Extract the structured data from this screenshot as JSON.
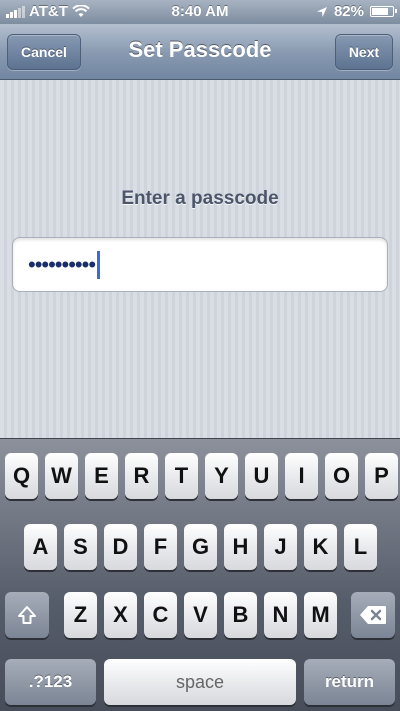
{
  "status_bar": {
    "carrier": "AT&T",
    "time": "8:40 AM",
    "battery_percent": "82%",
    "battery_level": 0.82,
    "signal_icon": "signal-bars-icon",
    "wifi_icon": "wifi-icon",
    "location_icon": "location-arrow-icon"
  },
  "nav": {
    "cancel_label": "Cancel",
    "title": "Set Passcode",
    "next_label": "Next"
  },
  "main": {
    "prompt": "Enter a passcode",
    "passcode_masked": "••••••••••"
  },
  "keyboard": {
    "row1": [
      "Q",
      "W",
      "E",
      "R",
      "T",
      "Y",
      "U",
      "I",
      "O",
      "P"
    ],
    "row2": [
      "A",
      "S",
      "D",
      "F",
      "G",
      "H",
      "J",
      "K",
      "L"
    ],
    "row3": [
      "Z",
      "X",
      "C",
      "V",
      "B",
      "N",
      "M"
    ],
    "shift_icon": "shift-arrow-icon",
    "delete_icon": "backspace-icon",
    "numbers_label": ".?123",
    "space_label": "space",
    "return_label": "return"
  }
}
